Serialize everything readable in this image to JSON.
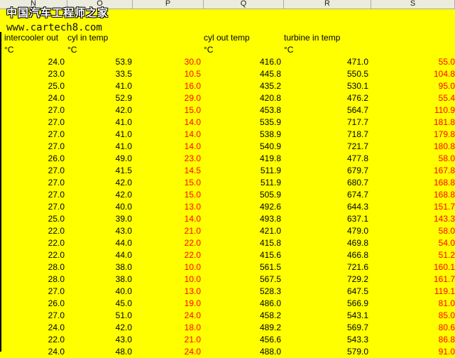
{
  "columns": [
    "N",
    "O",
    "P",
    "Q",
    "R",
    "S"
  ],
  "watermark": {
    "site_name_cn": "中国汽车工程师之家",
    "url": "www.cartech8.com"
  },
  "headers": {
    "intercooler_out": "intercooler out",
    "cyl_in_temp": "cyl in temp",
    "cyl_out_temp": "cyl out temp",
    "turbine_in_temp": "turbine in temp",
    "left_clip": "t"
  },
  "units": {
    "n": "°C",
    "o": "°C",
    "q": "°C",
    "r": "°C"
  },
  "rows": [
    [
      "24.0",
      "53.9",
      "30.0",
      "416.0",
      "471.0",
      "55.0"
    ],
    [
      "23.0",
      "33.5",
      "10.5",
      "445.8",
      "550.5",
      "104.8"
    ],
    [
      "25.0",
      "41.0",
      "16.0",
      "435.2",
      "530.1",
      "95.0"
    ],
    [
      "24.0",
      "52.9",
      "29.0",
      "420.8",
      "476.2",
      "55.4"
    ],
    [
      "27.0",
      "42.0",
      "15.0",
      "453.8",
      "564.7",
      "110.9"
    ],
    [
      "27.0",
      "41.0",
      "14.0",
      "535.9",
      "717.7",
      "181.8"
    ],
    [
      "27.0",
      "41.0",
      "14.0",
      "538.9",
      "718.7",
      "179.8"
    ],
    [
      "27.0",
      "41.0",
      "14.0",
      "540.9",
      "721.7",
      "180.8"
    ],
    [
      "26.0",
      "49.0",
      "23.0",
      "419.8",
      "477.8",
      "58.0"
    ],
    [
      "27.0",
      "41.5",
      "14.5",
      "511.9",
      "679.7",
      "167.8"
    ],
    [
      "27.0",
      "42.0",
      "15.0",
      "511.9",
      "680.7",
      "168.8"
    ],
    [
      "27.0",
      "42.0",
      "15.0",
      "505.9",
      "674.7",
      "168.8"
    ],
    [
      "27.0",
      "40.0",
      "13.0",
      "492.6",
      "644.3",
      "151.7"
    ],
    [
      "25.0",
      "39.0",
      "14.0",
      "493.8",
      "637.1",
      "143.3"
    ],
    [
      "22.0",
      "43.0",
      "21.0",
      "421.0",
      "479.0",
      "58.0"
    ],
    [
      "22.0",
      "44.0",
      "22.0",
      "415.8",
      "469.8",
      "54.0"
    ],
    [
      "22.0",
      "44.0",
      "22.0",
      "415.6",
      "466.8",
      "51.2"
    ],
    [
      "28.0",
      "38.0",
      "10.0",
      "561.5",
      "721.6",
      "160.1"
    ],
    [
      "28.0",
      "38.0",
      "10.0",
      "567.5",
      "729.2",
      "161.7"
    ],
    [
      "27.0",
      "40.0",
      "13.0",
      "528.3",
      "647.5",
      "119.1"
    ],
    [
      "26.0",
      "45.0",
      "19.0",
      "486.0",
      "566.9",
      "81.0"
    ],
    [
      "27.0",
      "51.0",
      "24.0",
      "458.2",
      "543.1",
      "85.0"
    ],
    [
      "24.0",
      "42.0",
      "18.0",
      "489.2",
      "569.7",
      "80.6"
    ],
    [
      "22.0",
      "43.0",
      "21.0",
      "456.6",
      "543.3",
      "86.8"
    ],
    [
      "24.0",
      "48.0",
      "24.0",
      "488.0",
      "579.0",
      "91.0"
    ]
  ]
}
